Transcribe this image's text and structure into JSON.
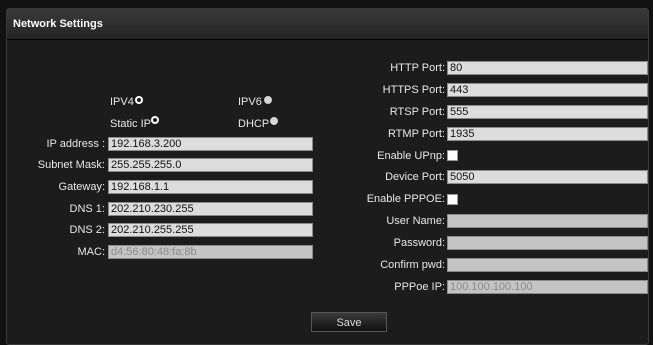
{
  "panel": {
    "title": "Network Settings"
  },
  "left": {
    "ipv4_label": "IPV4",
    "ipv6_label": "IPV6",
    "static_ip_label": "Static IP",
    "dhcp_label": "DHCP",
    "ip_address_label": "IP address :",
    "ip_address_value": "192.168.3.200",
    "subnet_label": "Subnet Mask:",
    "subnet_value": "255.255.255.0",
    "gateway_label": "Gateway:",
    "gateway_value": "192.168.1.1",
    "dns1_label": "DNS 1:",
    "dns1_value": "202.210.230.255",
    "dns2_label": "DNS 2:",
    "dns2_value": "202.210.255.255",
    "mac_label": "MAC:",
    "mac_value": "d4:56:80:48:fa:8b"
  },
  "right": {
    "http_label": "HTTP Port:",
    "http_value": "80",
    "https_label": "HTTPS Port:",
    "https_value": "443",
    "rtsp_label": "RTSP Port:",
    "rtsp_value": "555",
    "rtmp_label": "RTMP Port:",
    "rtmp_value": "1935",
    "upnp_label": "Enable UPnp:",
    "device_port_label": "Device Port:",
    "device_port_value": "5050",
    "pppoe_label": "Enable PPPOE:",
    "username_label": "User Name:",
    "username_value": "",
    "password_label": "Password:",
    "password_value": "",
    "confirm_label": "Confirm pwd:",
    "confirm_value": "",
    "pppoe_ip_label": "PPPoe IP:",
    "pppoe_ip_value": "100.100.100.100"
  },
  "actions": {
    "save_label": "Save"
  }
}
